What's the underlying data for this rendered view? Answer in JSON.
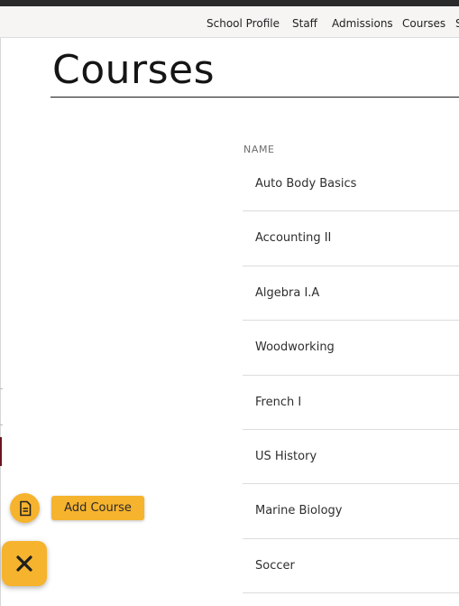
{
  "nav": {
    "items": [
      {
        "label": "School Profile"
      },
      {
        "label": "Staff"
      },
      {
        "label": "Admissions"
      },
      {
        "label": "Courses"
      },
      {
        "label": "S"
      }
    ]
  },
  "page": {
    "title": "Courses"
  },
  "table": {
    "column_header": "NAME",
    "rows": [
      {
        "name": "Auto Body Basics"
      },
      {
        "name": "Accounting II"
      },
      {
        "name": "Algebra I.A"
      },
      {
        "name": "Woodworking"
      },
      {
        "name": "French I"
      },
      {
        "name": "US History"
      },
      {
        "name": "Marine Biology"
      },
      {
        "name": "Soccer"
      }
    ]
  },
  "fab": {
    "add_course_label": "Add Course",
    "doc_icon": "document-icon",
    "close_icon": "close-icon"
  },
  "colors": {
    "accent": "#f6b32d",
    "topbar": "#2a2a2a",
    "left_accent": "#6b1420"
  }
}
